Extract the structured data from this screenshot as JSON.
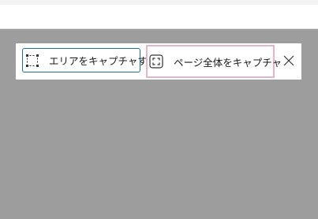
{
  "capture_toolbar": {
    "capture_area_label": "エリアをキャプチャする",
    "capture_full_page_label": "ページ全体をキャプチャ",
    "icons": {
      "capture_area": "region-select-icon",
      "capture_full_page": "full-page-capture-icon",
      "close": "close-icon"
    },
    "colors": {
      "focus_border": "#1a6fa0",
      "hover_border": "#e7b3c8",
      "overlay": "#9d9d9d"
    }
  }
}
